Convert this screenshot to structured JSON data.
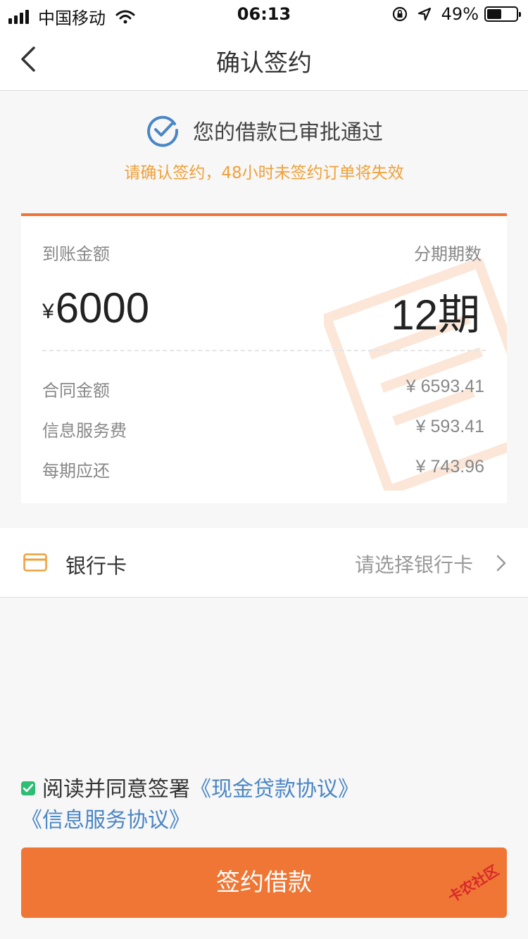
{
  "status_bar": {
    "carrier": "中国移动",
    "time": "06:13",
    "battery": "49%",
    "battery_level": 0.49
  },
  "nav": {
    "title": "确认签约"
  },
  "approval": {
    "message": "您的借款已审批通过",
    "warning": "请确认签约，48小时未签约订单将失效"
  },
  "loan": {
    "received_label": "到账金额",
    "currency": "¥",
    "received_amount": "6000",
    "periods_label": "分期期数",
    "periods_value": "12期",
    "details": [
      {
        "label": "合同金额",
        "value": "¥ 6593.41"
      },
      {
        "label": "信息服务费",
        "value": "¥ 593.41"
      },
      {
        "label": "每期应还",
        "value": "¥ 743.96"
      }
    ]
  },
  "bank": {
    "label": "银行卡",
    "placeholder": "请选择银行卡"
  },
  "agreement": {
    "prefix": "阅读并同意签署",
    "link1": "《现金贷款协议》",
    "link2": "《信息服务协议》",
    "checked": true
  },
  "submit_label": "签约借款",
  "watermark_badge": "卡农社区",
  "colors": {
    "accent": "#ef7634",
    "warning": "#f0a03a",
    "link": "#4a86c5",
    "check": "#2dbd73",
    "approval_icon": "#4a86c5"
  }
}
